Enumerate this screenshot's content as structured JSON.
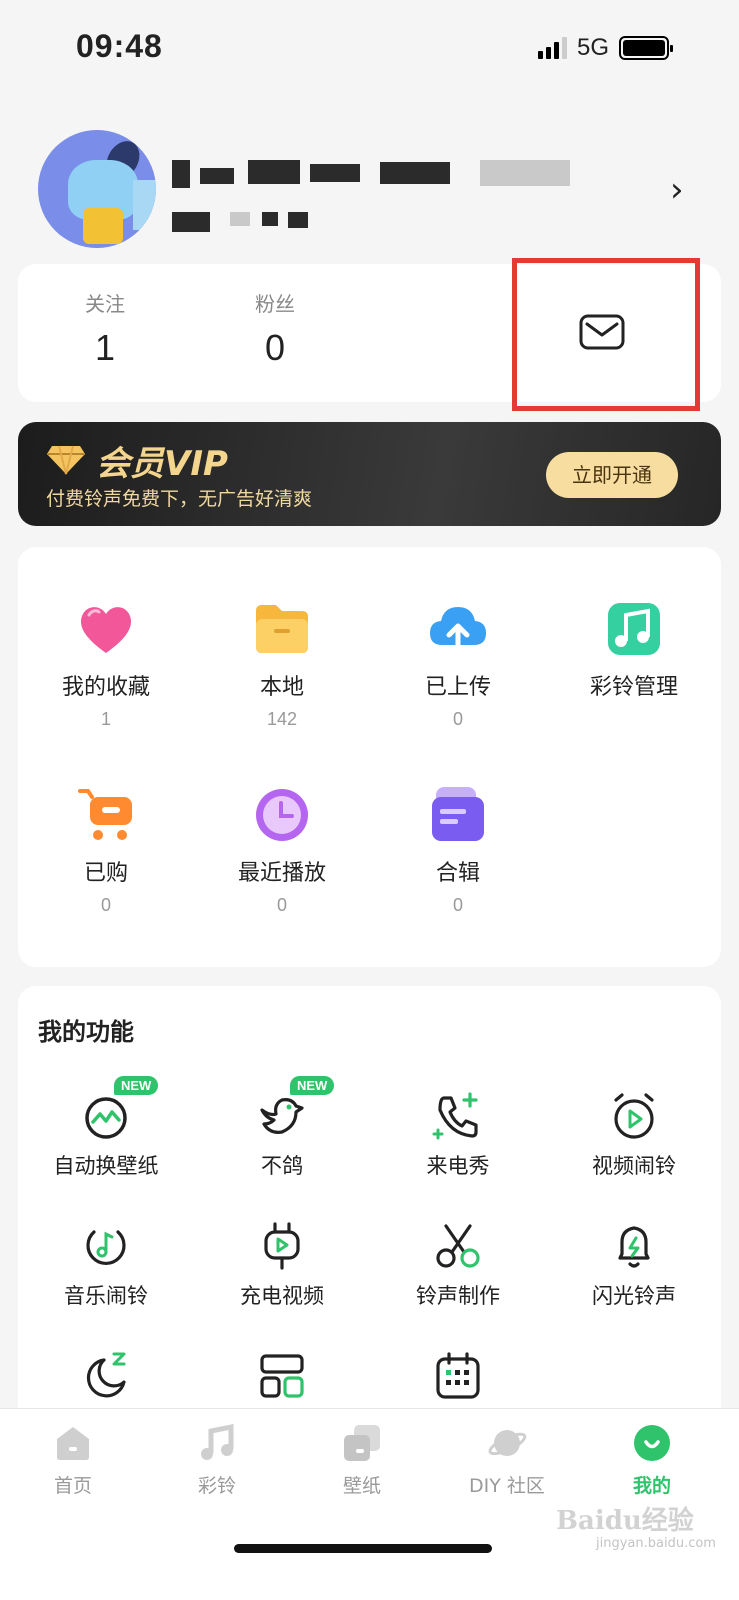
{
  "status_bar": {
    "time": "09:48",
    "network": "5G"
  },
  "profile": {
    "arrow": "›"
  },
  "stats": [
    {
      "label": "关注",
      "value": "1"
    },
    {
      "label": "粉丝",
      "value": "0"
    }
  ],
  "vip": {
    "title": "会员VIP",
    "subtitle": "付费铃声免费下，无广告好清爽",
    "button": "立即开通"
  },
  "grid": [
    {
      "label": "我的收藏",
      "count": "1",
      "icon": "heart-icon"
    },
    {
      "label": "本地",
      "count": "142",
      "icon": "folder-icon"
    },
    {
      "label": "已上传",
      "count": "0",
      "icon": "cloud-upload-icon"
    },
    {
      "label": "彩铃管理",
      "count": "",
      "icon": "music-note-icon"
    },
    {
      "label": "已购",
      "count": "0",
      "icon": "cart-icon"
    },
    {
      "label": "最近播放",
      "count": "0",
      "icon": "clock-icon"
    },
    {
      "label": "合辑",
      "count": "0",
      "icon": "album-icon"
    }
  ],
  "functions": {
    "title": "我的功能",
    "badge": "NEW",
    "items": [
      {
        "label": "自动换壁纸",
        "icon": "auto-wallpaper-icon",
        "new": true
      },
      {
        "label": "不鸽",
        "icon": "bird-icon",
        "new": true
      },
      {
        "label": "来电秀",
        "icon": "phone-icon",
        "new": false
      },
      {
        "label": "视频闹铃",
        "icon": "video-alarm-icon",
        "new": false
      },
      {
        "label": "音乐闹铃",
        "icon": "music-alarm-icon",
        "new": false
      },
      {
        "label": "充电视频",
        "icon": "charging-video-icon",
        "new": false
      },
      {
        "label": "铃声制作",
        "icon": "scissors-icon",
        "new": false
      },
      {
        "label": "闪光铃声",
        "icon": "flash-bell-icon",
        "new": false
      },
      {
        "label": "",
        "icon": "moon-sleep-icon",
        "new": false
      },
      {
        "label": "",
        "icon": "widget-icon",
        "new": false
      },
      {
        "label": "",
        "icon": "calendar-icon",
        "new": false
      }
    ]
  },
  "tabs": [
    {
      "label": "首页",
      "icon": "home-icon"
    },
    {
      "label": "彩铃",
      "icon": "music-icon"
    },
    {
      "label": "壁纸",
      "icon": "wallpaper-icon"
    },
    {
      "label": "DIY 社区",
      "icon": "planet-icon"
    },
    {
      "label": "我的",
      "icon": "profile-icon"
    }
  ],
  "watermark": {
    "main": "Baidu经验",
    "sub": "jingyan.baidu.com"
  },
  "colors": {
    "accent": "#2fc36b",
    "highlight": "#e53935",
    "vip_gold": "#f4d58d"
  }
}
